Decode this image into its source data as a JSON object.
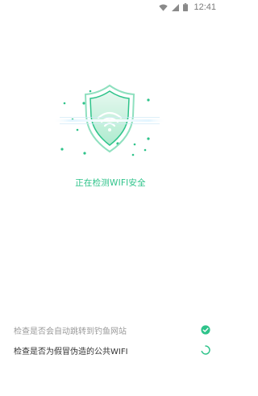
{
  "status_bar": {
    "time": "12:41",
    "icons": [
      "wifi-icon",
      "cell-signal-icon",
      "battery-icon"
    ]
  },
  "scanner": {
    "status_text": "正在检测WIFI安全",
    "accent_color": "#2ec38a"
  },
  "checks": [
    {
      "label": "检查是否会自动跳转到钓鱼网站",
      "state": "done",
      "icon": "check-circle-icon"
    },
    {
      "label": "检查是否为假冒伪造的公共WIFI",
      "state": "loading",
      "icon": "loading-spinner-icon"
    }
  ]
}
